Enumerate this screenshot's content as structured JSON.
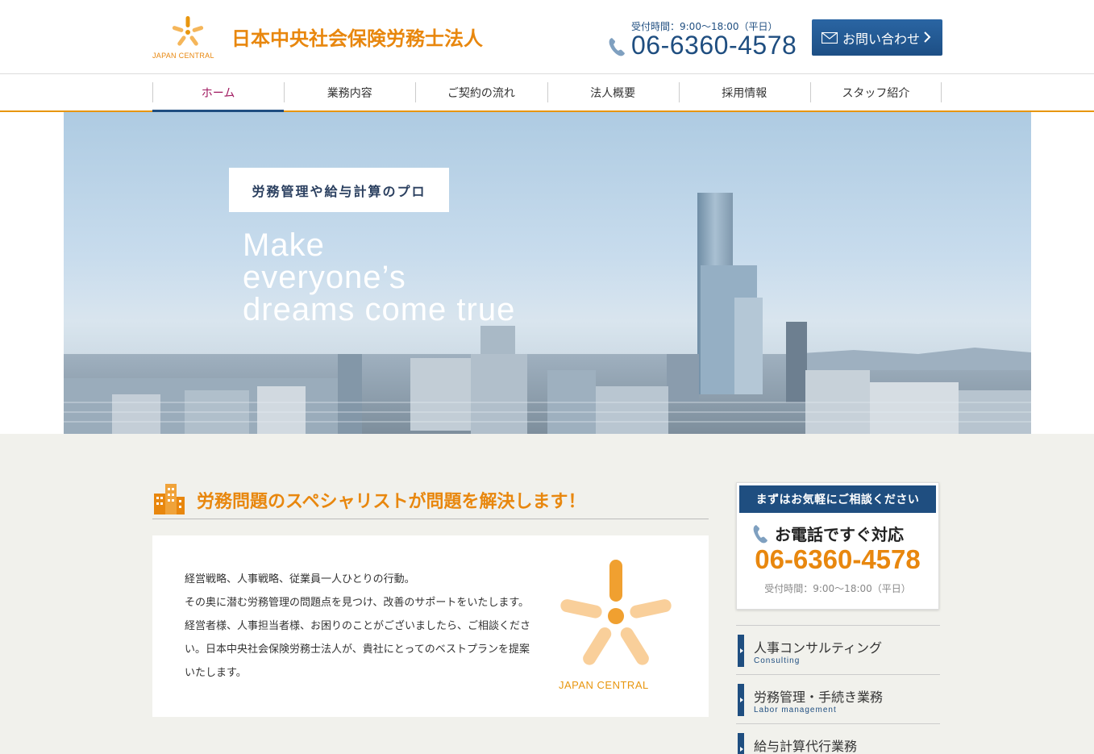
{
  "header": {
    "company_name": "日本中央社会保険労務士法人",
    "logo_text": "JAPAN CENTRAL",
    "hours": "受付時間：9:00〜18:00（平日）",
    "phone": "06-6360-4578",
    "contact_label": "お問い合わせ"
  },
  "nav": {
    "items": [
      {
        "label": "ホーム"
      },
      {
        "label": "業務内容"
      },
      {
        "label": "ご契約の流れ"
      },
      {
        "label": "法人概要"
      },
      {
        "label": "採用情報"
      },
      {
        "label": "スタッフ紹介"
      }
    ]
  },
  "hero": {
    "tagline": "労務管理や給与計算のプロ",
    "copy": "Make\neveryone’s\ndreams come true"
  },
  "main": {
    "section_title": "労務問題のスペシャリストが問題を解決します！",
    "intro": "経営戦略、人事戦略、従業員一人ひとりの行動。\nその奥に潜む労務管理の問題点を見つけ、改善のサポートをいたします。経営者様、人事担当者様、お困りのことがございましたら、ご相談ください。日本中央社会保険労務士法人が、貴社にとってのベストプランを提案いたします。",
    "logo_text": "JAPAN CENTRAL"
  },
  "sidebar": {
    "cta_head": "まずはお気軽にご相談ください",
    "cta_title": "お電話ですぐ対応",
    "cta_phone": "06-6360-4578",
    "cta_hours": "受付時間：9:00〜18:00（平日）",
    "menu": [
      {
        "jp": "人事コンサルティング",
        "en": "Consulting"
      },
      {
        "jp": "労務管理・手続き業務",
        "en": "Labor management"
      },
      {
        "jp": "給与計算代行業務",
        "en": ""
      }
    ]
  },
  "colors": {
    "brand_orange": "#e8870e",
    "brand_navy": "#1f4e80",
    "nav_active": "#a0185f"
  }
}
